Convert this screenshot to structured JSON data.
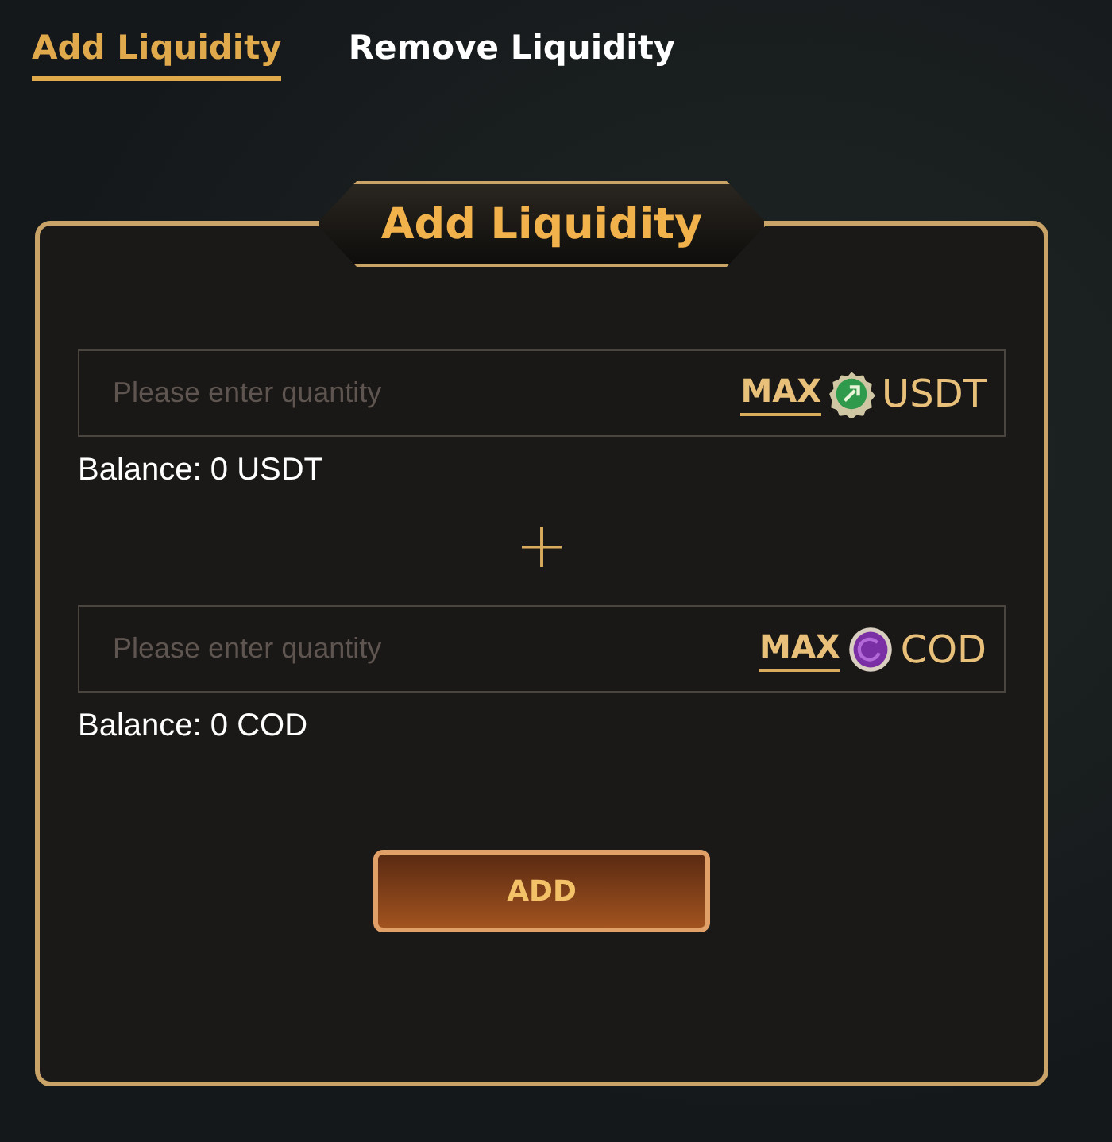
{
  "tabs": [
    {
      "label": "Add Liquidity",
      "selected": true
    },
    {
      "label": "Remove Liquidity",
      "selected": false
    }
  ],
  "panel": {
    "title": "Add Liquidity"
  },
  "fields": [
    {
      "placeholder": "Please enter quantity",
      "max": "MAX",
      "token": "USDT",
      "balance": "Balance: 0 USDT"
    },
    {
      "placeholder": "Please enter quantity",
      "max": "MAX",
      "token": "COD",
      "balance": "Balance: 0 COD"
    }
  ],
  "separator": "+",
  "button": "ADD"
}
